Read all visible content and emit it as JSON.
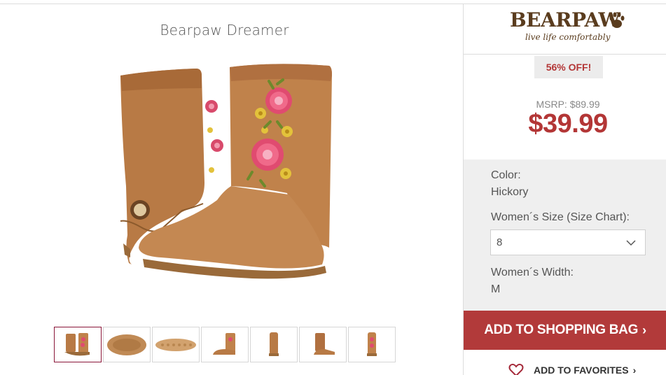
{
  "product": {
    "title": "Bearpaw Dreamer",
    "image_alt": "Bearpaw Dreamer boots with embroidered roses, Hickory"
  },
  "thumbnails": [
    {
      "name": "pair-side",
      "active": true
    },
    {
      "name": "sole-bottom",
      "active": false
    },
    {
      "name": "sole-tread",
      "active": false
    },
    {
      "name": "single-side",
      "active": false
    },
    {
      "name": "single-front",
      "active": false
    },
    {
      "name": "single-back",
      "active": false
    },
    {
      "name": "single-inner",
      "active": false
    }
  ],
  "brand": {
    "name": "BEARPAW",
    "tagline": "live life comfortably",
    "color": "#5a3c1e"
  },
  "pricing": {
    "discount_label": "56% OFF!",
    "msrp_label": "MSRP: $89.99",
    "price": "$39.99",
    "accent_color": "#b33636"
  },
  "options": {
    "color_label": "Color:",
    "color_value": "Hickory",
    "size_label": "Women´s Size (Size Chart):",
    "size_value": "8",
    "width_label": "Women´s Width:",
    "width_value": "M"
  },
  "actions": {
    "add_to_bag": "ADD TO SHOPPING BAG",
    "add_to_favorites": "ADD TO FAVORITES"
  },
  "icons": [
    "heart-icon",
    "chevron-down-icon",
    "chevron-right-icon",
    "paw-icon"
  ]
}
